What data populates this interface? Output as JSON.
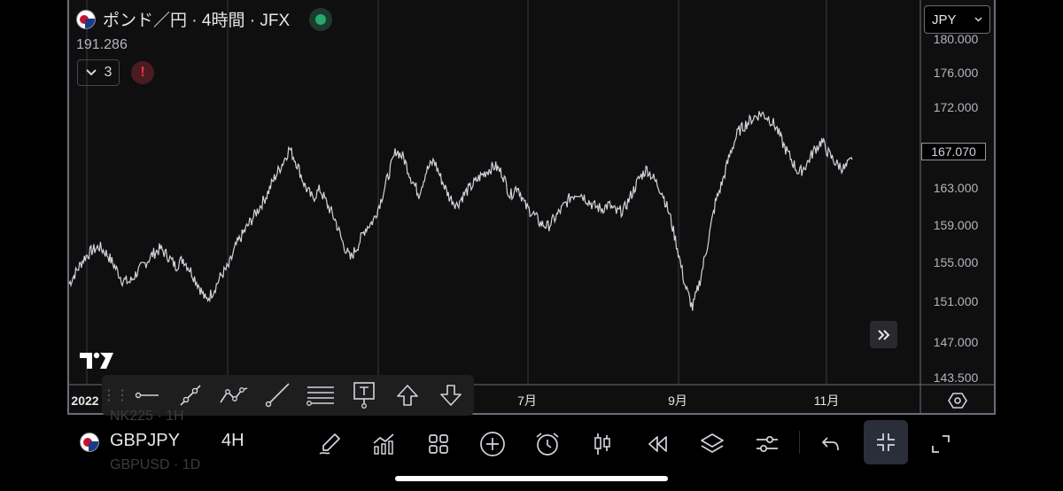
{
  "header": {
    "symbol_title": "ポンド／円 · 4時間 · JFX",
    "price": "191.286",
    "indicator_count": "3",
    "warning": "!",
    "currency": "JPY"
  },
  "price_scale": {
    "ticks": [
      "180.000",
      "176.000",
      "172.000",
      "167.070",
      "163.000",
      "159.000",
      "155.000",
      "151.000",
      "147.000",
      "143.500"
    ],
    "last_price": "167.070",
    "colors": {
      "last_price_border": "#9598a1"
    }
  },
  "time_scale": {
    "labels": [
      "2022",
      "7月",
      "9月",
      "11月"
    ]
  },
  "chart_data": {
    "type": "line",
    "ylim": [
      143.5,
      180
    ],
    "series": [
      {
        "values": [
          153.6,
          155.0,
          156.4,
          157.2,
          157.6,
          156.8,
          155.5,
          154.0,
          153.8,
          154.9,
          155.8,
          156.8,
          157.4,
          156.6,
          155.5,
          156.3,
          155.0,
          153.5,
          151.8,
          152.9,
          154.5,
          155.5,
          157.8,
          159.2,
          160.5,
          161.8,
          163.2,
          165.0,
          166.5,
          168.2,
          166.5,
          164.2,
          162.8,
          163.8,
          162.1,
          160.5,
          158.0,
          156.3,
          157.8,
          159.6,
          160.4,
          162.6,
          165.3,
          168.0,
          167.2,
          165.0,
          163.3,
          165.8,
          166.9,
          164.8,
          163.0,
          162.1,
          163.3,
          164.2,
          165.1,
          165.8,
          166.3,
          165.5,
          163.1,
          164.2,
          162.0,
          161.2,
          160.1,
          159.8,
          160.8,
          161.9,
          163.0,
          163.5,
          162.8,
          162.0,
          161.7,
          162.1,
          161.3,
          161.6,
          163.3,
          165.0,
          166.0,
          164.8,
          163.5,
          161.0,
          157.5,
          153.5,
          151.0,
          154.0,
          158.0,
          162.3,
          164.8,
          167.8,
          170.0,
          170.8,
          171.5,
          172.0,
          171.5,
          170.5,
          168.5,
          167.0,
          165.5,
          166.5,
          168.0,
          169.0,
          167.5,
          166.5,
          166.0,
          167.0
        ]
      }
    ],
    "grid": true,
    "colors": {
      "line": "#d1d4dc",
      "grid": "#363a45",
      "background": "#0f0f0f"
    }
  },
  "drawing_toolbar": {
    "tools": [
      "horizontal-line-icon",
      "trend-line-icon",
      "path-icon",
      "ray-icon",
      "parallel-lines-icon",
      "text-tool-icon",
      "arrow-up-icon",
      "arrow-down-icon"
    ]
  },
  "bottom_bar": {
    "symbol": "GBPJPY",
    "timeframe": "4H",
    "ghost_above": "NK225 · 1H",
    "ghost_below": "GBPUSD · 1D",
    "icons": [
      "brush-icon",
      "indicators-icon",
      "layouts-icon",
      "add-icon",
      "alarm-icon",
      "candles-icon",
      "replay-icon",
      "layers-icon",
      "settings-sliders-icon",
      "undo-icon",
      "collapse-icon",
      "expand-icon"
    ]
  }
}
